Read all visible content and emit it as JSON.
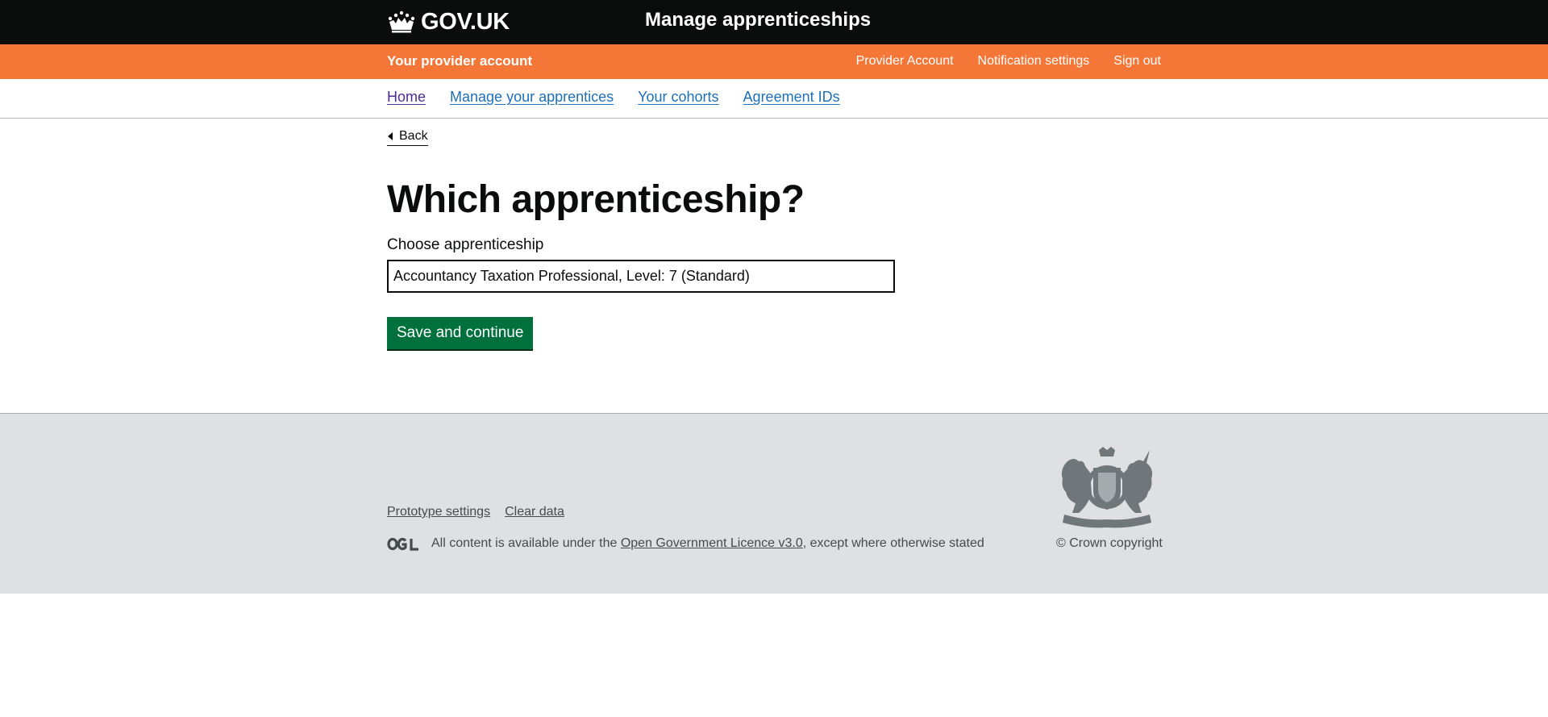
{
  "header": {
    "logo_text": "GOV.UK",
    "service_name": "Manage apprenticeships",
    "icons": {
      "logo": "crown-icon"
    }
  },
  "account_bar": {
    "title": "Your provider account",
    "links": [
      "Provider Account",
      "Notification settings",
      "Sign out"
    ],
    "color": "#f47738"
  },
  "subnav": {
    "items": [
      "Home",
      "Manage your apprentices",
      "Your cohorts",
      "Agreement IDs"
    ]
  },
  "back_link": "Back",
  "main": {
    "title": "Which apprenticeship?",
    "field_label": "Choose apprenticeship",
    "field_value": "Accountancy Taxation Professional, Level: 7 (Standard)",
    "button_label": "Save and continue",
    "button_color": "#00703c"
  },
  "footer": {
    "links": [
      "Prototype settings",
      "Clear data"
    ],
    "licence_prefix": "All content is available under the ",
    "licence_link": "Open Government Licence v3.0",
    "licence_suffix": ", except where otherwise stated",
    "copyright": "© Crown copyright",
    "icons": {
      "ogl": "ogl-logo-icon",
      "crest": "royal-coat-of-arms-icon"
    }
  }
}
